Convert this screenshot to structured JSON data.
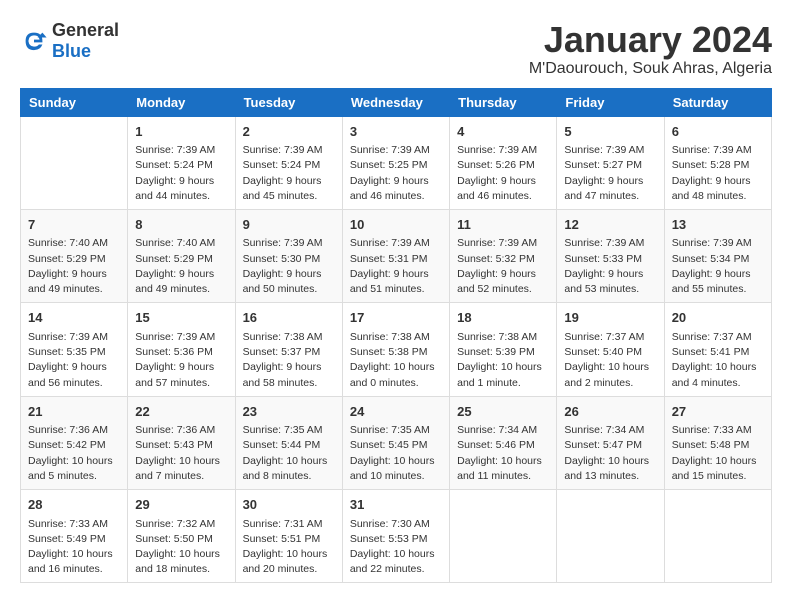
{
  "logo": {
    "text_general": "General",
    "text_blue": "Blue"
  },
  "title": "January 2024",
  "location": "M'Daourouch, Souk Ahras, Algeria",
  "weekdays": [
    "Sunday",
    "Monday",
    "Tuesday",
    "Wednesday",
    "Thursday",
    "Friday",
    "Saturday"
  ],
  "weeks": [
    [
      {
        "day": "",
        "sunrise": "",
        "sunset": "",
        "daylight": ""
      },
      {
        "day": "1",
        "sunrise": "Sunrise: 7:39 AM",
        "sunset": "Sunset: 5:24 PM",
        "daylight": "Daylight: 9 hours and 44 minutes."
      },
      {
        "day": "2",
        "sunrise": "Sunrise: 7:39 AM",
        "sunset": "Sunset: 5:24 PM",
        "daylight": "Daylight: 9 hours and 45 minutes."
      },
      {
        "day": "3",
        "sunrise": "Sunrise: 7:39 AM",
        "sunset": "Sunset: 5:25 PM",
        "daylight": "Daylight: 9 hours and 46 minutes."
      },
      {
        "day": "4",
        "sunrise": "Sunrise: 7:39 AM",
        "sunset": "Sunset: 5:26 PM",
        "daylight": "Daylight: 9 hours and 46 minutes."
      },
      {
        "day": "5",
        "sunrise": "Sunrise: 7:39 AM",
        "sunset": "Sunset: 5:27 PM",
        "daylight": "Daylight: 9 hours and 47 minutes."
      },
      {
        "day": "6",
        "sunrise": "Sunrise: 7:39 AM",
        "sunset": "Sunset: 5:28 PM",
        "daylight": "Daylight: 9 hours and 48 minutes."
      }
    ],
    [
      {
        "day": "7",
        "sunrise": "Sunrise: 7:40 AM",
        "sunset": "Sunset: 5:29 PM",
        "daylight": "Daylight: 9 hours and 49 minutes."
      },
      {
        "day": "8",
        "sunrise": "Sunrise: 7:40 AM",
        "sunset": "Sunset: 5:29 PM",
        "daylight": "Daylight: 9 hours and 49 minutes."
      },
      {
        "day": "9",
        "sunrise": "Sunrise: 7:39 AM",
        "sunset": "Sunset: 5:30 PM",
        "daylight": "Daylight: 9 hours and 50 minutes."
      },
      {
        "day": "10",
        "sunrise": "Sunrise: 7:39 AM",
        "sunset": "Sunset: 5:31 PM",
        "daylight": "Daylight: 9 hours and 51 minutes."
      },
      {
        "day": "11",
        "sunrise": "Sunrise: 7:39 AM",
        "sunset": "Sunset: 5:32 PM",
        "daylight": "Daylight: 9 hours and 52 minutes."
      },
      {
        "day": "12",
        "sunrise": "Sunrise: 7:39 AM",
        "sunset": "Sunset: 5:33 PM",
        "daylight": "Daylight: 9 hours and 53 minutes."
      },
      {
        "day": "13",
        "sunrise": "Sunrise: 7:39 AM",
        "sunset": "Sunset: 5:34 PM",
        "daylight": "Daylight: 9 hours and 55 minutes."
      }
    ],
    [
      {
        "day": "14",
        "sunrise": "Sunrise: 7:39 AM",
        "sunset": "Sunset: 5:35 PM",
        "daylight": "Daylight: 9 hours and 56 minutes."
      },
      {
        "day": "15",
        "sunrise": "Sunrise: 7:39 AM",
        "sunset": "Sunset: 5:36 PM",
        "daylight": "Daylight: 9 hours and 57 minutes."
      },
      {
        "day": "16",
        "sunrise": "Sunrise: 7:38 AM",
        "sunset": "Sunset: 5:37 PM",
        "daylight": "Daylight: 9 hours and 58 minutes."
      },
      {
        "day": "17",
        "sunrise": "Sunrise: 7:38 AM",
        "sunset": "Sunset: 5:38 PM",
        "daylight": "Daylight: 10 hours and 0 minutes."
      },
      {
        "day": "18",
        "sunrise": "Sunrise: 7:38 AM",
        "sunset": "Sunset: 5:39 PM",
        "daylight": "Daylight: 10 hours and 1 minute."
      },
      {
        "day": "19",
        "sunrise": "Sunrise: 7:37 AM",
        "sunset": "Sunset: 5:40 PM",
        "daylight": "Daylight: 10 hours and 2 minutes."
      },
      {
        "day": "20",
        "sunrise": "Sunrise: 7:37 AM",
        "sunset": "Sunset: 5:41 PM",
        "daylight": "Daylight: 10 hours and 4 minutes."
      }
    ],
    [
      {
        "day": "21",
        "sunrise": "Sunrise: 7:36 AM",
        "sunset": "Sunset: 5:42 PM",
        "daylight": "Daylight: 10 hours and 5 minutes."
      },
      {
        "day": "22",
        "sunrise": "Sunrise: 7:36 AM",
        "sunset": "Sunset: 5:43 PM",
        "daylight": "Daylight: 10 hours and 7 minutes."
      },
      {
        "day": "23",
        "sunrise": "Sunrise: 7:35 AM",
        "sunset": "Sunset: 5:44 PM",
        "daylight": "Daylight: 10 hours and 8 minutes."
      },
      {
        "day": "24",
        "sunrise": "Sunrise: 7:35 AM",
        "sunset": "Sunset: 5:45 PM",
        "daylight": "Daylight: 10 hours and 10 minutes."
      },
      {
        "day": "25",
        "sunrise": "Sunrise: 7:34 AM",
        "sunset": "Sunset: 5:46 PM",
        "daylight": "Daylight: 10 hours and 11 minutes."
      },
      {
        "day": "26",
        "sunrise": "Sunrise: 7:34 AM",
        "sunset": "Sunset: 5:47 PM",
        "daylight": "Daylight: 10 hours and 13 minutes."
      },
      {
        "day": "27",
        "sunrise": "Sunrise: 7:33 AM",
        "sunset": "Sunset: 5:48 PM",
        "daylight": "Daylight: 10 hours and 15 minutes."
      }
    ],
    [
      {
        "day": "28",
        "sunrise": "Sunrise: 7:33 AM",
        "sunset": "Sunset: 5:49 PM",
        "daylight": "Daylight: 10 hours and 16 minutes."
      },
      {
        "day": "29",
        "sunrise": "Sunrise: 7:32 AM",
        "sunset": "Sunset: 5:50 PM",
        "daylight": "Daylight: 10 hours and 18 minutes."
      },
      {
        "day": "30",
        "sunrise": "Sunrise: 7:31 AM",
        "sunset": "Sunset: 5:51 PM",
        "daylight": "Daylight: 10 hours and 20 minutes."
      },
      {
        "day": "31",
        "sunrise": "Sunrise: 7:30 AM",
        "sunset": "Sunset: 5:53 PM",
        "daylight": "Daylight: 10 hours and 22 minutes."
      },
      {
        "day": "",
        "sunrise": "",
        "sunset": "",
        "daylight": ""
      },
      {
        "day": "",
        "sunrise": "",
        "sunset": "",
        "daylight": ""
      },
      {
        "day": "",
        "sunrise": "",
        "sunset": "",
        "daylight": ""
      }
    ]
  ]
}
